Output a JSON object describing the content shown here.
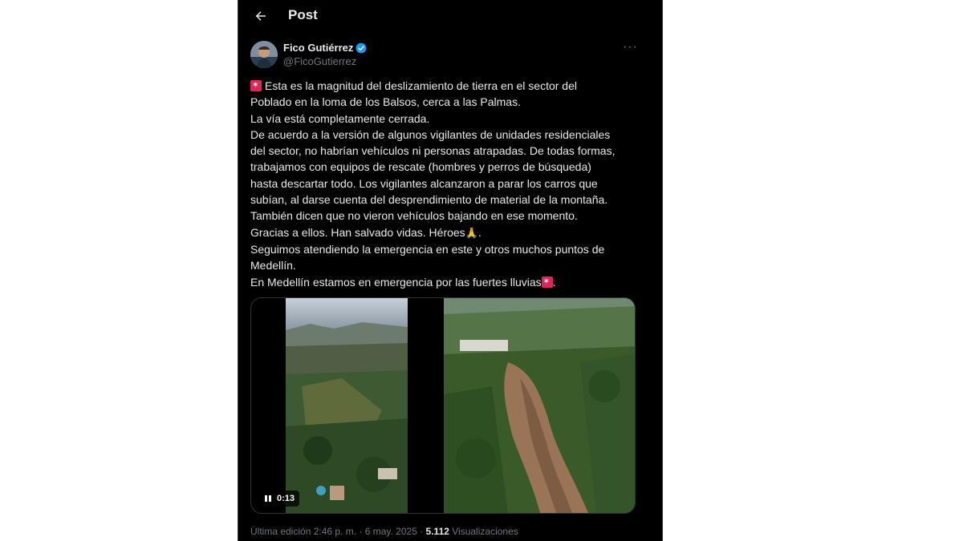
{
  "header": {
    "title": "Post"
  },
  "author": {
    "name": "Fico Gutiérrez",
    "handle": "@FicoGutierrez"
  },
  "post": {
    "lines": [
      "Esta es la magnitud del deslizamiento de tierra en el sector del",
      "Poblado en la loma de los Balsos, cerca a las Palmas.",
      "La vía está completamente cerrada.",
      "De acuerdo a la versión de algunos vigilantes de unidades residenciales",
      "del sector, no habrían vehículos ni personas atrapadas. De todas formas,",
      "trabajamos con equipos de rescate (hombres y perros de búsqueda)",
      "hasta descartar todo. Los vigilantes alcanzaron a parar los carros que",
      "subían, al darse cuenta del desprendimiento de material de la montaña.",
      "También dicen que no vieron vehículos bajando en ese momento.",
      "Gracias a ellos. Han salvado vidas. Héroes",
      "Seguimos atendiendo la emergencia en este y otros muchos puntos de",
      "Medellín.",
      "En Medellín estamos en emergencia por las fuertes lluvias"
    ],
    "trailing_period": "."
  },
  "media": {
    "video_time": "0:13"
  },
  "meta": {
    "edited": "Última edición 2:46 p. m. · 6 may. 2025 · ",
    "views_count": "5.112",
    "views_label": " Visualizaciones"
  },
  "icons": {
    "back": "arrow-left-icon",
    "verified": "verified-badge-icon",
    "more": "more-icon",
    "siren": "siren-emoji-icon",
    "pray": "praying-hands-emoji-icon",
    "pause": "pause-icon"
  },
  "colors": {
    "background": "#000000",
    "text": "#e7e9ea",
    "muted": "#71767b",
    "verified": "#1d9bf0",
    "siren": "#e0245e"
  }
}
